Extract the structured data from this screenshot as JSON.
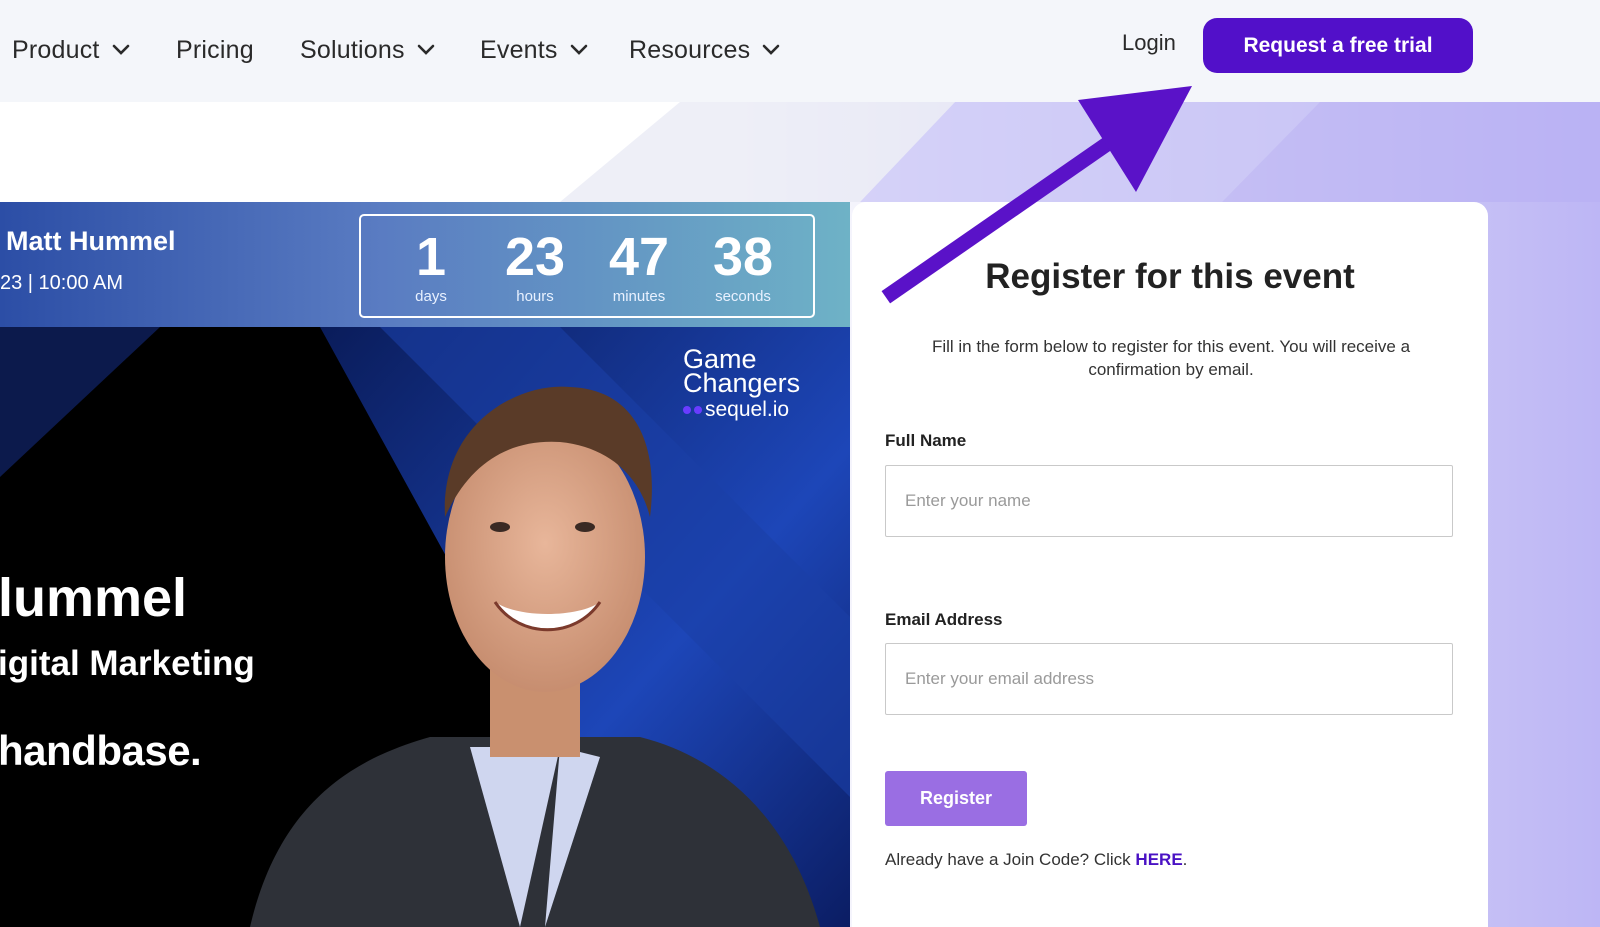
{
  "nav": {
    "items": [
      {
        "label": "Product",
        "has_dropdown": true
      },
      {
        "label": "Pricing",
        "has_dropdown": false
      },
      {
        "label": "Solutions",
        "has_dropdown": true
      },
      {
        "label": "Events",
        "has_dropdown": true
      },
      {
        "label": "Resources",
        "has_dropdown": true
      }
    ],
    "login": "Login",
    "cta": "Request a free trial"
  },
  "event": {
    "speaker": "Matt Hummel",
    "datetime": "23 | 10:00 AM",
    "countdown": {
      "days": "1",
      "days_label": "days",
      "hours": "23",
      "hours_label": "hours",
      "minutes": "47",
      "minutes_label": "minutes",
      "seconds": "38",
      "seconds_label": "seconds"
    },
    "banner": {
      "name_fragment": "lummel",
      "title_fragment": "igital Marketing",
      "company_fragment": "handbase.",
      "logo_line1": "Game",
      "logo_line2": "Changers",
      "logo_sub": "sequel.io"
    }
  },
  "form": {
    "title": "Register for this event",
    "description": "Fill in the form below to register for this event. You will receive a confirmation by email.",
    "full_name_label": "Full Name",
    "full_name_placeholder": "Enter your name",
    "email_label": "Email Address",
    "email_placeholder": "Enter your email address",
    "register_label": "Register",
    "join_prefix": "Already have a Join Code? Click ",
    "join_link": "HERE",
    "join_suffix": "."
  },
  "colors": {
    "brand_purple": "#5210c9",
    "register_purple": "#9a6ee3",
    "arrow_purple": "#5a12c8"
  }
}
